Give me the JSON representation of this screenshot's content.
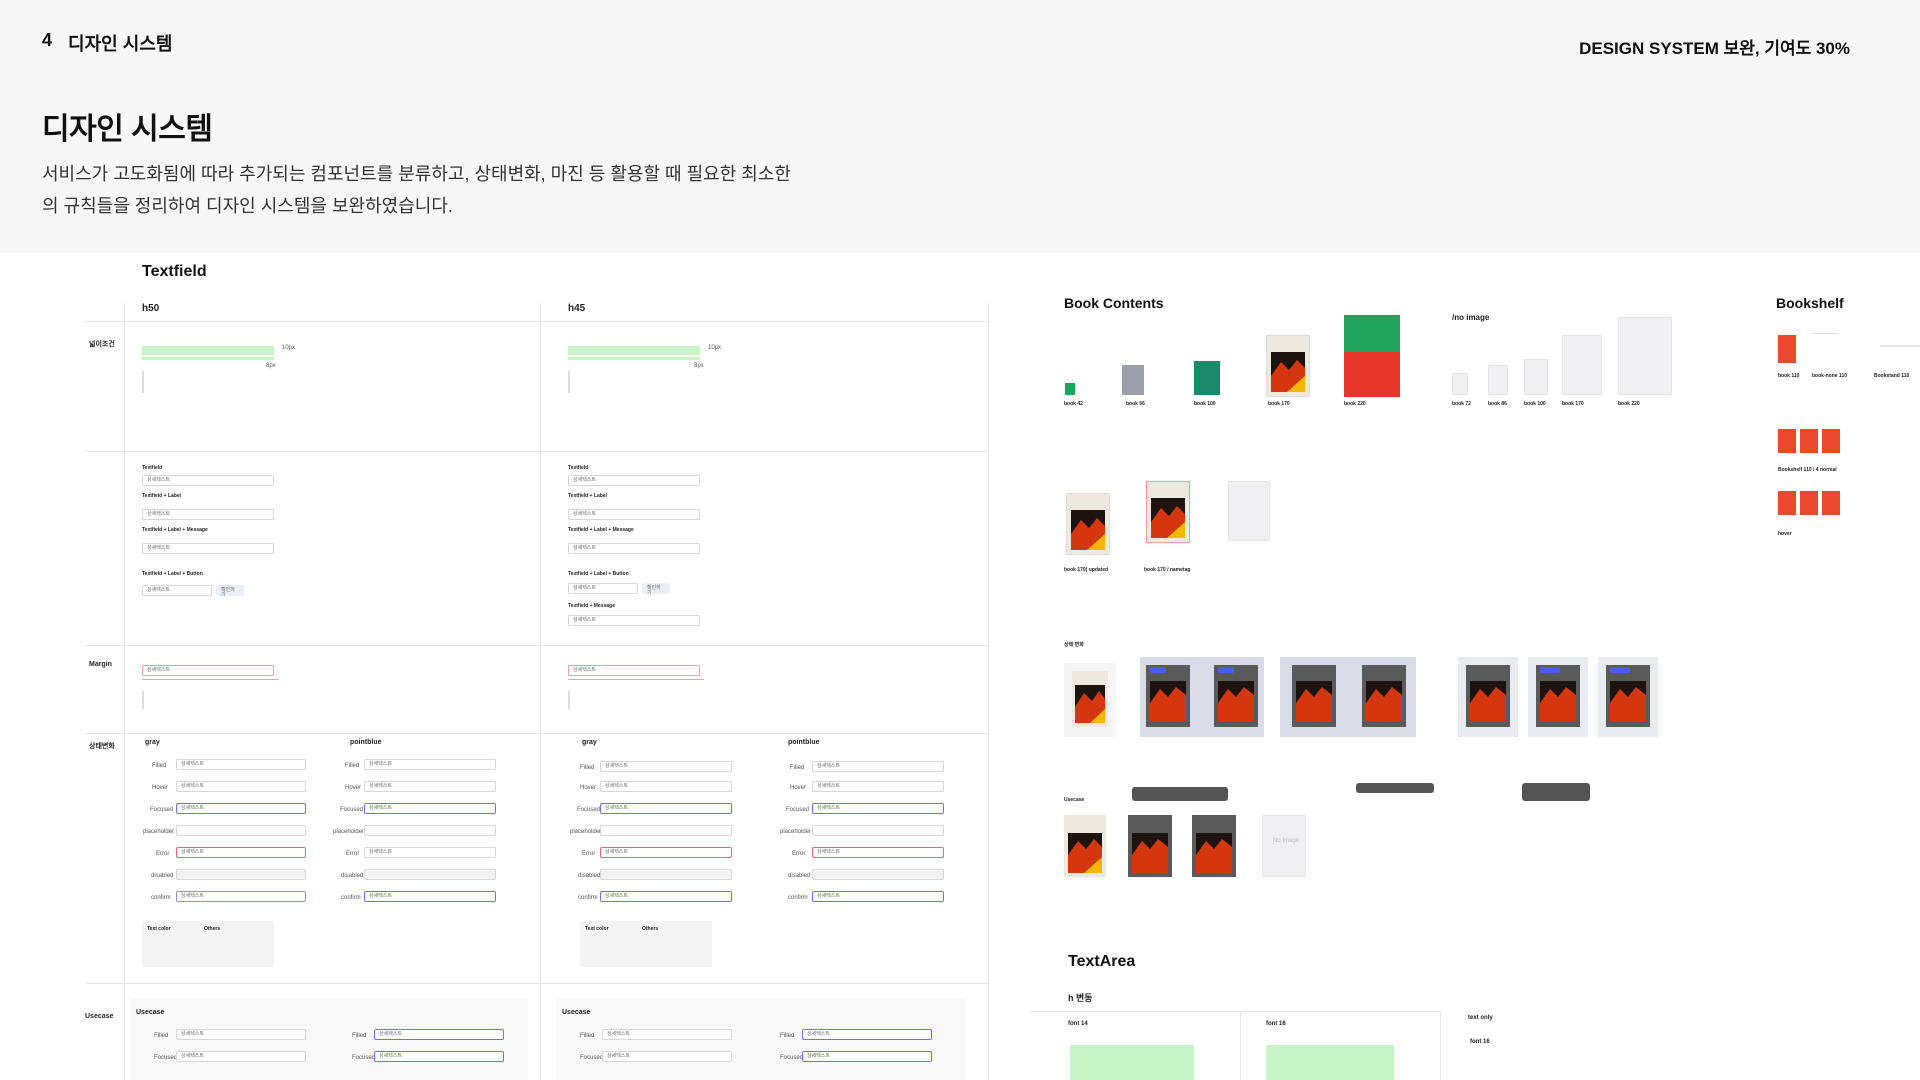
{
  "header": {
    "section_number": "4",
    "section_title": "디자인 시스템",
    "contribution": "DESIGN SYSTEM 보완, 기여도 30%"
  },
  "main": {
    "title": "디자인 시스템",
    "description_line1": "서비스가 고도화됨에 따라 추가되는 컴포넌트를 분류하고, 상태변화, 마진 등 활용할 때 필요한 최소한",
    "description_line2": "의 규칙들을 정리하여 디자인 시스템을 보완하였습니다."
  },
  "textfield": {
    "title": "Textfield",
    "col_h50": "h50",
    "col_h45": "h45",
    "rows": {
      "width_condition": "넓이조건",
      "margin": "Margin",
      "state": "상태변화",
      "usecase": "Usecase"
    },
    "variants": [
      "Textfield",
      "Textfield + Label",
      "Textfield + Label + Message",
      "Textfield + Label + Button",
      "Textfield + Message"
    ],
    "group_gray": "gray",
    "group_pointblue": "pointblue",
    "states": [
      "Filled",
      "Hover",
      "Focused",
      "placeholder",
      "Error",
      "disabled",
      "confirm"
    ],
    "field_text": "상세텍스트",
    "button_label": "확인하기",
    "notes": {
      "text_color": "Text color",
      "others": "Others"
    },
    "usecase_label": "Usecase",
    "usecase_states": [
      "Filled",
      "Focused"
    ],
    "padding_labels": [
      "10px",
      "8px"
    ]
  },
  "book_contents": {
    "title": "Book Contents",
    "sizes": [
      "book 42",
      "book 66",
      "book 100",
      "book 170",
      "book 220"
    ],
    "no_image_title": "/no image",
    "no_image_sizes": [
      "book 72",
      "book 86",
      "book 100",
      "book 170",
      "book 220"
    ],
    "updated": [
      "book 170( updated",
      "book 170 / nametag"
    ],
    "state_change": "상태 변화",
    "usecase": "Usecase",
    "no_image_text": "No Image"
  },
  "bookshelf": {
    "title": "Bookshelf",
    "items": [
      "book 110",
      "book-none 110",
      "Bookstand 110"
    ],
    "normal": "Bookshelf 110 / 4 normal",
    "hover": "hover"
  },
  "textarea": {
    "title": "TextArea",
    "subtitle": "h 변동",
    "col1": "font 14",
    "col2": "font 16",
    "col3_title": "text only",
    "col3_font": "font 16"
  },
  "colors": {
    "green": "#1fa35b",
    "red": "#e8352b",
    "point_blue": "#4a5df0",
    "error": "#e46a73",
    "spacing_green": "#c7f3c7"
  }
}
